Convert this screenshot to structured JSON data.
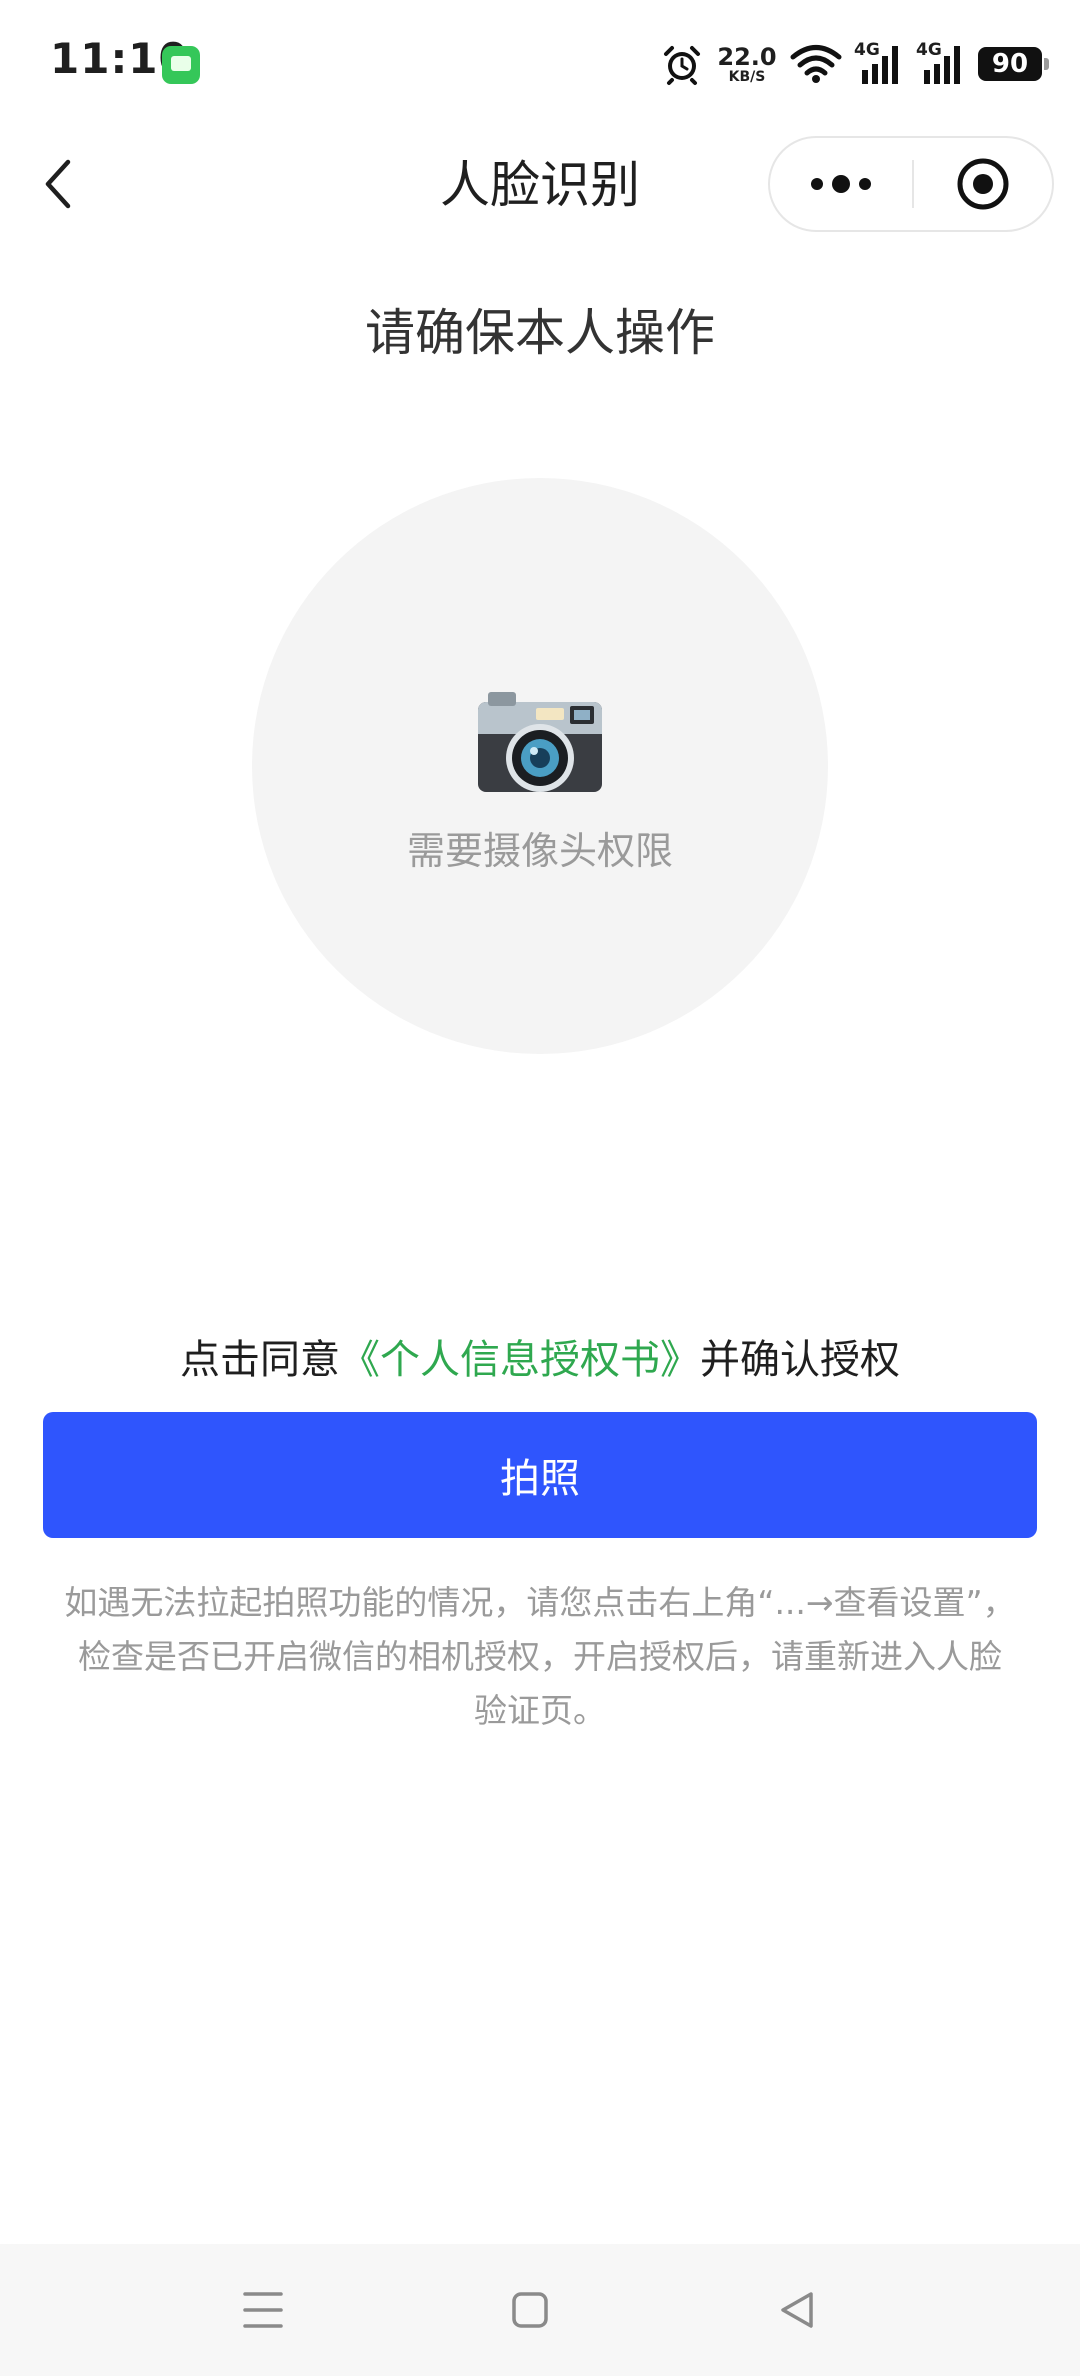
{
  "status_bar": {
    "time": "11:10",
    "net_speed_value": "22.0",
    "net_speed_unit": "KB/S",
    "signal_1_label": "4G",
    "signal_2_label": "4G",
    "battery": "90"
  },
  "nav": {
    "title": "人脸识别"
  },
  "main": {
    "heading": "请确保本人操作",
    "camera_hint": "需要摄像头权限",
    "consent_prefix": "点击同意",
    "consent_link": "《个人信息授权书》",
    "consent_suffix": "并确认授权",
    "photo_button_label": "拍照",
    "help_text": "如遇无法拉起拍照功能的情况，请您点击右上角“...→查看设置”，检查是否已开启微信的相机授权，开启授权后，请重新进入人脸验证页。"
  },
  "colors": {
    "primary_button": "#2f55fd",
    "link": "#2fa84f",
    "hint_text": "#9a9a9a"
  },
  "icons": {
    "back": "chevron-left-icon",
    "more": "more-dots-icon",
    "close": "target-circle-icon",
    "camera": "camera-icon",
    "menu": "menu-lines-icon",
    "home": "square-icon",
    "sys_back": "triangle-back-icon"
  }
}
